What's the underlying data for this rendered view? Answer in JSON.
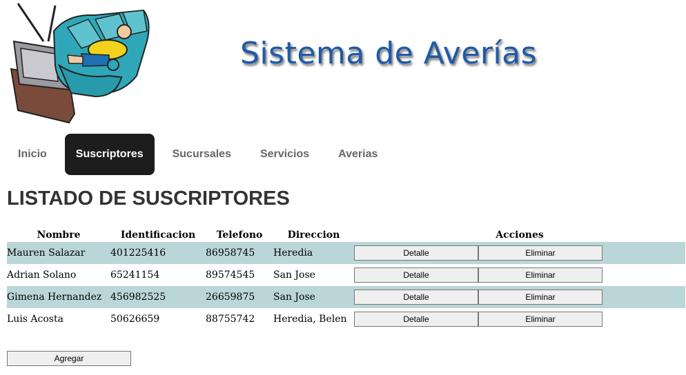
{
  "header": {
    "logo": "tv-couch-logo",
    "title": "Sistema de Averías"
  },
  "nav": {
    "items": [
      {
        "label": "Inicio"
      },
      {
        "label": "Suscriptores",
        "active": true
      },
      {
        "label": "Sucursales"
      },
      {
        "label": "Servicios"
      },
      {
        "label": "Averias"
      }
    ]
  },
  "page": {
    "title": "LISTADO DE SUSCRIPTORES"
  },
  "table": {
    "columns": [
      "Nombre",
      "Identificacion",
      "Telefono",
      "Direccion",
      "Acciones"
    ],
    "rows": [
      {
        "nombre": "Mauren Salazar",
        "identificacion": "401225416",
        "telefono": "86958745",
        "direccion": "Heredia"
      },
      {
        "nombre": "Adrian Solano",
        "identificacion": "65241154",
        "telefono": "89574545",
        "direccion": "San Jose"
      },
      {
        "nombre": "Gimena Hernandez",
        "identificacion": "456982525",
        "telefono": "26659875",
        "direccion": "San Jose"
      },
      {
        "nombre": "Luis Acosta",
        "identificacion": "50626659",
        "telefono": "88755742",
        "direccion": "Heredia, Belen"
      }
    ],
    "actions": {
      "detail_label": "Detalle",
      "delete_label": "Eliminar"
    }
  },
  "add_button": {
    "label": "Agregar"
  },
  "colors": {
    "row_stripe": "#bad6d8",
    "nav_active": "#1d1d1d",
    "title_blue": "#1f5aa6"
  }
}
